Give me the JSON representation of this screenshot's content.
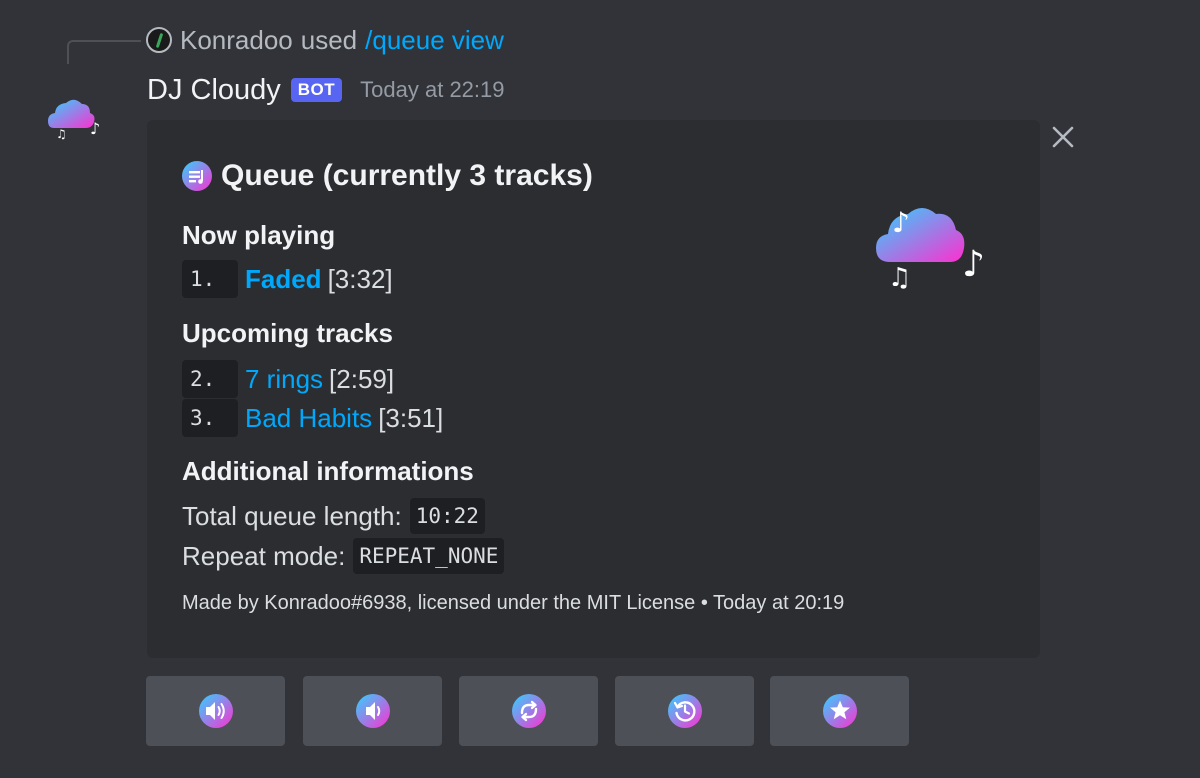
{
  "reply": {
    "user": "Konradoo",
    "verb": "used",
    "command": "/queue view"
  },
  "message": {
    "author": "DJ Cloudy",
    "badge": "BOT",
    "timestamp": "Today at 22:19"
  },
  "embed": {
    "title": "Queue (currently 3 tracks)",
    "now_playing": {
      "label": "Now playing",
      "track": {
        "index": "1.",
        "title": "Faded",
        "duration": "[3:32]"
      }
    },
    "upcoming": {
      "label": "Upcoming tracks",
      "tracks": [
        {
          "index": "2.",
          "title": "7 rings",
          "duration": "[2:59]"
        },
        {
          "index": "3.",
          "title": "Bad Habits",
          "duration": "[3:51]"
        }
      ]
    },
    "additional": {
      "label": "Additional informations",
      "total_label": "Total queue length:",
      "total_value": "10:22",
      "repeat_label": "Repeat mode:",
      "repeat_value": "REPEAT_NONE"
    },
    "footer": "Made by Konradoo#6938, licensed under the MIT License • Today at 20:19"
  },
  "buttons": [
    {
      "icon": "volume-up-icon"
    },
    {
      "icon": "volume-down-icon"
    },
    {
      "icon": "repeat-icon"
    },
    {
      "icon": "history-icon"
    },
    {
      "icon": "star-icon"
    }
  ],
  "colors": {
    "background": "#313338",
    "embed": "#2b2d31",
    "link": "#00a8fc",
    "badge": "#5865f2",
    "button": "#4e5058",
    "gradient_start": "#2fd3ff",
    "gradient_end": "#ff2fd0"
  }
}
